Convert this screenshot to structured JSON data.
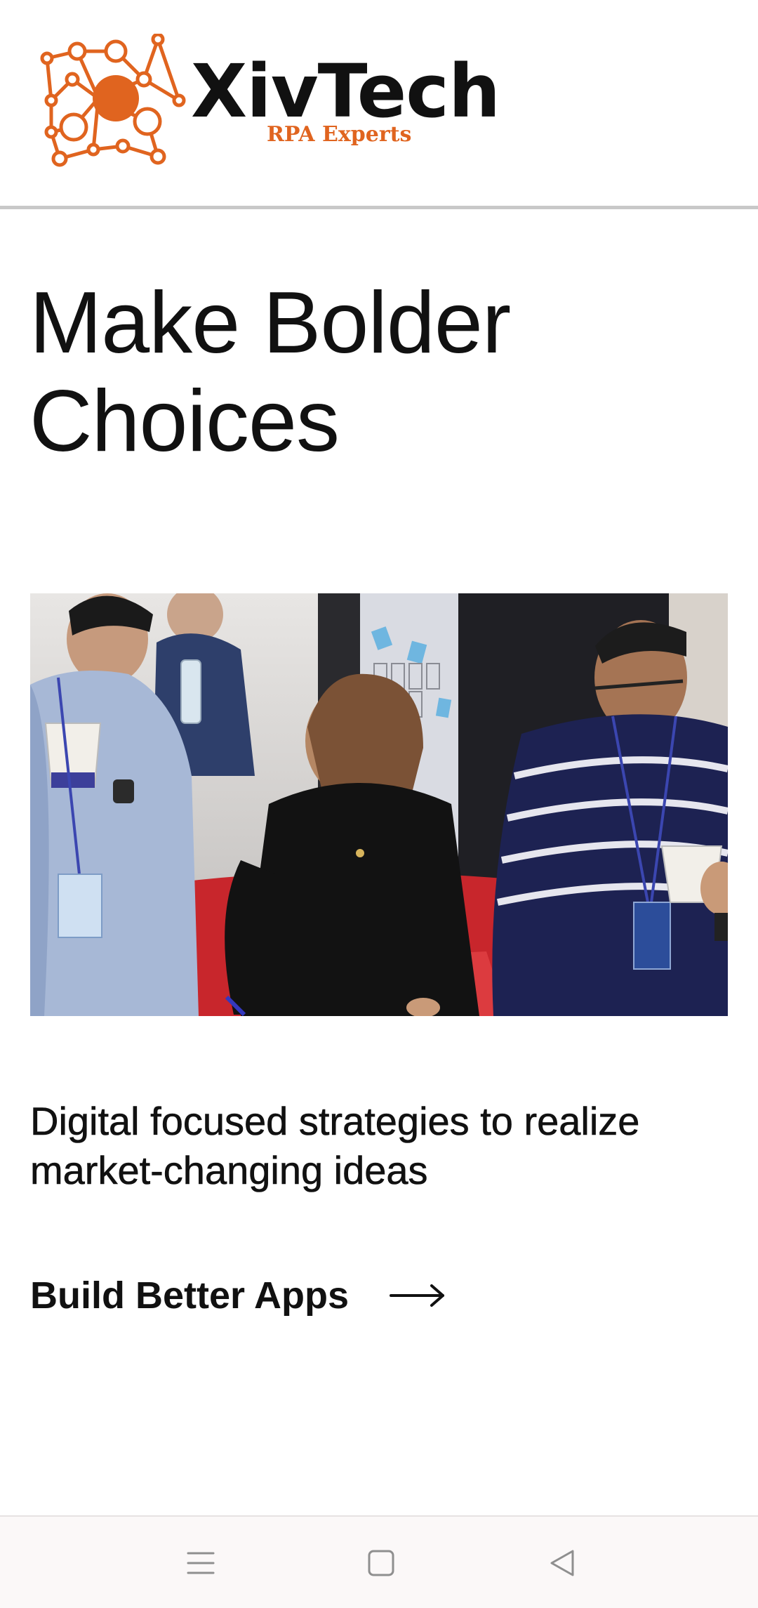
{
  "header": {
    "brand_name": "XivTech",
    "brand_tagline": "RPA Experts",
    "brand_color": "#e0641f"
  },
  "hero": {
    "title_line1": "Make Bolder",
    "title_line2": "Choices"
  },
  "content": {
    "subheading": "Digital focused strategies to realize market-changing ideas",
    "cta_label": "Build Better Apps",
    "cta_icon": "arrow-right-icon"
  },
  "nav_bar": {
    "menu_icon": "menu-icon",
    "home_icon": "home-square-icon",
    "back_icon": "back-triangle-icon"
  }
}
